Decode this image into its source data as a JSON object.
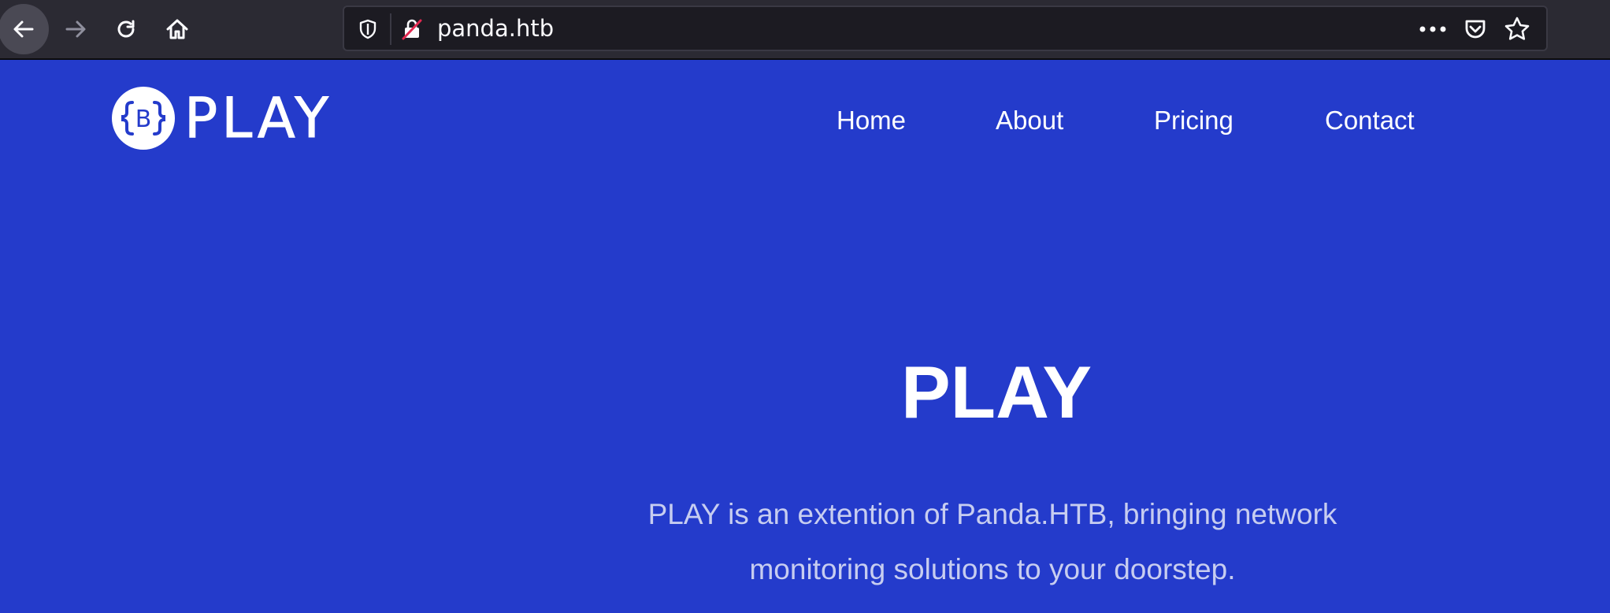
{
  "browser": {
    "url": "panda.htb",
    "icons": {
      "back": "arrow-left-icon",
      "forward": "arrow-right-icon",
      "reload": "reload-icon",
      "home": "home-icon",
      "tracking_protection": "shield-icon",
      "insecure_connection": "lock-slashed-icon",
      "page_actions": "ellipsis-icon",
      "pocket": "pocket-icon",
      "bookmark": "star-icon"
    }
  },
  "site": {
    "logo_text": "PLAY",
    "logo_mark_letter": "B",
    "nav": {
      "home": "Home",
      "about": "About",
      "pricing": "Pricing",
      "contact": "Contact"
    },
    "hero": {
      "title": "PLAY",
      "description": "PLAY is an extention of Panda.HTB, bringing network monitoring solutions to your doorstep."
    }
  },
  "colors": {
    "toolbar_bg": "#2b2a33",
    "urlbar_bg": "#1c1b22",
    "page_bg": "#243bcb",
    "text_primary": "#ffffff",
    "text_muted": "#c7cdf0",
    "insecure_red": "#e22850"
  }
}
